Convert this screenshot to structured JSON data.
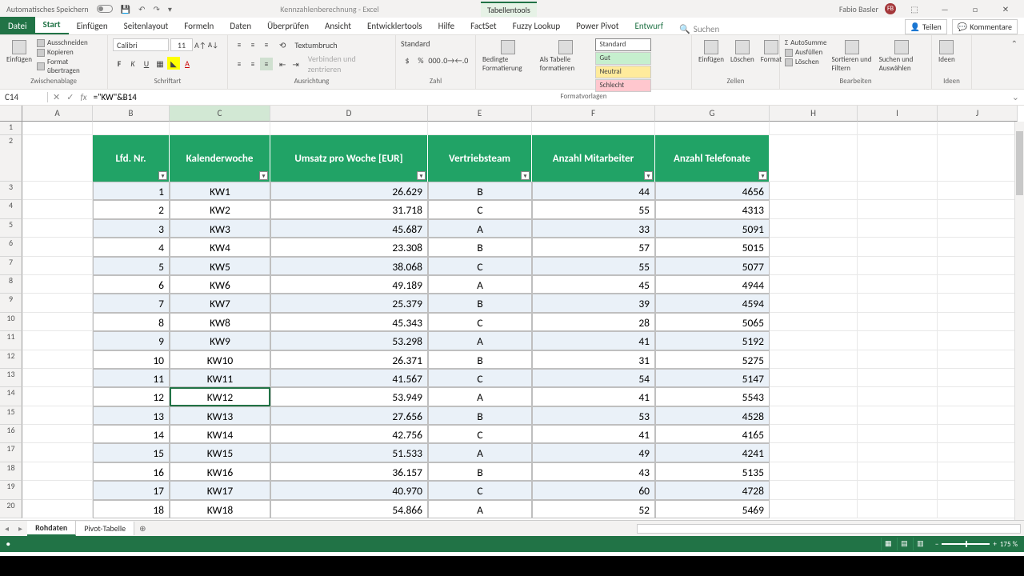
{
  "titlebar": {
    "autosave": "Automatisches Speichern",
    "doc_title": "Kennzahlenberechnung  -  Excel",
    "tabtools": "Tabellentools",
    "user": "Fabio Basler",
    "user_initials": "FB"
  },
  "tabs": {
    "file": "Datei",
    "start": "Start",
    "einfugen": "Einfügen",
    "seitenlayout": "Seitenlayout",
    "formeln": "Formeln",
    "daten": "Daten",
    "uberprufen": "Überprüfen",
    "ansicht": "Ansicht",
    "entwickler": "Entwicklertools",
    "hilfe": "Hilfe",
    "factset": "FactSet",
    "fuzzy": "Fuzzy Lookup",
    "powerpivot": "Power Pivot",
    "entwurf": "Entwurf",
    "search": "Suchen",
    "teilen": "Teilen",
    "kommentare": "Kommentare"
  },
  "ribbon": {
    "paste": "Einfügen",
    "cut": "Ausschneiden",
    "copy": "Kopieren",
    "formatpaint": "Format übertragen",
    "g_clipboard": "Zwischenablage",
    "font_name": "Calibri",
    "font_size": "11",
    "g_font": "Schriftart",
    "wrap": "Textumbruch",
    "merge": "Verbinden und zentrieren",
    "g_align": "Ausrichtung",
    "numfmt": "Standard",
    "g_number": "Zahl",
    "condfmt": "Bedingte Formatierung",
    "astable": "Als Tabelle formatieren",
    "g_styles": "Formatvorlagen",
    "style_std": "Standard",
    "style_gut": "Gut",
    "style_neutral": "Neutral",
    "style_schlecht": "Schlecht",
    "ins": "Einfügen",
    "del": "Löschen",
    "fmt": "Format",
    "g_cells": "Zellen",
    "autosum": "AutoSumme",
    "fill": "Ausfüllen",
    "clear": "Löschen",
    "sort": "Sortieren und Filtern",
    "find": "Suchen und Auswählen",
    "g_edit": "Bearbeiten",
    "ideen": "Ideen",
    "g_ideen": "Ideen"
  },
  "namebox": "C14",
  "formula": "=\"KW\"&B14",
  "columns": [
    "A",
    "B",
    "C",
    "D",
    "E",
    "F",
    "G",
    "H",
    "I",
    "J"
  ],
  "headers": {
    "lfd": "Lfd. Nr.",
    "kw": "Kalenderwoche",
    "umsatz": "Umsatz pro Woche [EUR]",
    "team": "Vertriebsteam",
    "ma": "Anzahl Mitarbeiter",
    "tel": "Anzahl Telefonate"
  },
  "rows": [
    {
      "n": 1,
      "kw": "KW1",
      "u": "26.629",
      "t": "B",
      "m": 44,
      "tel": 4656
    },
    {
      "n": 2,
      "kw": "KW2",
      "u": "31.718",
      "t": "C",
      "m": 55,
      "tel": 4313
    },
    {
      "n": 3,
      "kw": "KW3",
      "u": "45.687",
      "t": "A",
      "m": 33,
      "tel": 5091
    },
    {
      "n": 4,
      "kw": "KW4",
      "u": "23.308",
      "t": "B",
      "m": 57,
      "tel": 5015
    },
    {
      "n": 5,
      "kw": "KW5",
      "u": "38.068",
      "t": "C",
      "m": 55,
      "tel": 5077
    },
    {
      "n": 6,
      "kw": "KW6",
      "u": "49.189",
      "t": "A",
      "m": 45,
      "tel": 4944
    },
    {
      "n": 7,
      "kw": "KW7",
      "u": "25.379",
      "t": "B",
      "m": 39,
      "tel": 4594
    },
    {
      "n": 8,
      "kw": "KW8",
      "u": "45.343",
      "t": "C",
      "m": 28,
      "tel": 5065
    },
    {
      "n": 9,
      "kw": "KW9",
      "u": "53.298",
      "t": "A",
      "m": 41,
      "tel": 5192
    },
    {
      "n": 10,
      "kw": "KW10",
      "u": "26.371",
      "t": "B",
      "m": 31,
      "tel": 5275
    },
    {
      "n": 11,
      "kw": "KW11",
      "u": "41.567",
      "t": "C",
      "m": 54,
      "tel": 5147
    },
    {
      "n": 12,
      "kw": "KW12",
      "u": "53.949",
      "t": "A",
      "m": 41,
      "tel": 5543
    },
    {
      "n": 13,
      "kw": "KW13",
      "u": "27.656",
      "t": "B",
      "m": 53,
      "tel": 4528
    },
    {
      "n": 14,
      "kw": "KW14",
      "u": "42.756",
      "t": "C",
      "m": 41,
      "tel": 4165
    },
    {
      "n": 15,
      "kw": "KW15",
      "u": "51.533",
      "t": "A",
      "m": 49,
      "tel": 4241
    },
    {
      "n": 16,
      "kw": "KW16",
      "u": "36.157",
      "t": "B",
      "m": 43,
      "tel": 5135
    },
    {
      "n": 17,
      "kw": "KW17",
      "u": "40.970",
      "t": "C",
      "m": 60,
      "tel": 4728
    },
    {
      "n": 18,
      "kw": "KW18",
      "u": "54.866",
      "t": "A",
      "m": 52,
      "tel": 5469
    }
  ],
  "sheets": {
    "rohdaten": "Rohdaten",
    "pivot": "Pivot-Tabelle"
  },
  "status": {
    "zoom": "175 %"
  }
}
